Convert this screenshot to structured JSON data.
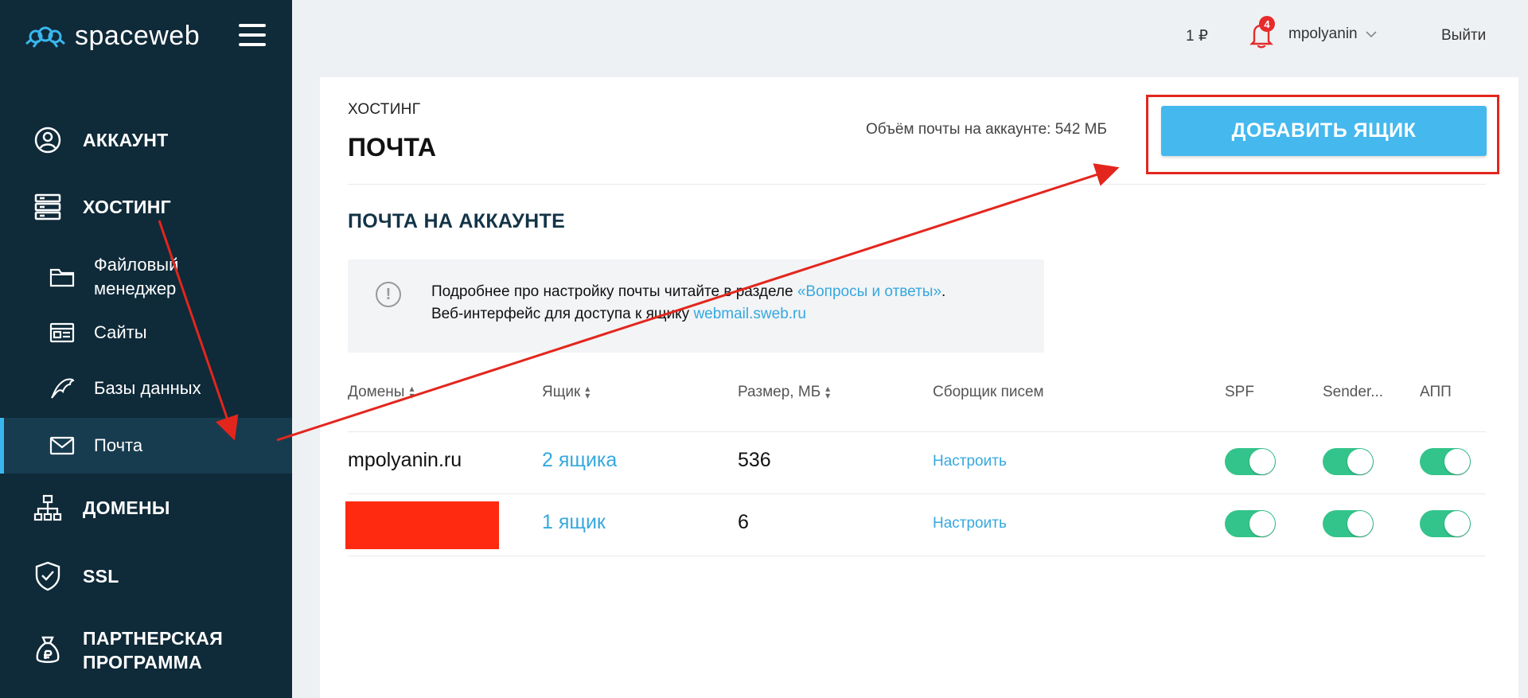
{
  "logo": {
    "text": "spaceweb"
  },
  "sidebar": {
    "items": [
      {
        "label": "АККАУНТ",
        "icon": "user-circle-icon"
      },
      {
        "label": "ХОСТИНГ",
        "icon": "server-icon"
      },
      {
        "label": "Файловый менеджер",
        "icon": "folder-icon"
      },
      {
        "label": "Сайты",
        "icon": "browser-window-icon"
      },
      {
        "label": "Базы данных",
        "icon": "dolphin-icon"
      },
      {
        "label": "Почта",
        "icon": "envelope-icon"
      },
      {
        "label": "ДОМЕНЫ",
        "icon": "sitemap-icon"
      },
      {
        "label": "SSL",
        "icon": "shield-check-icon"
      },
      {
        "label": "ПАРТНЕРСКАЯ ПРОГРАММА",
        "icon": "money-bag-icon"
      }
    ],
    "active": "Почта"
  },
  "header": {
    "balance": "1 ₽",
    "notifications_count": "4",
    "username": "mpolyanin",
    "logout": "Выйти"
  },
  "page": {
    "breadcrumb": "ХОСТИНГ",
    "title": "ПОЧТА",
    "volume": "Объём почты на аккаунте: 542 МБ",
    "add_button": "ДОБАВИТЬ ЯЩИК",
    "section_title": "ПОЧТА НА АККАУНТЕ",
    "info": {
      "line1_text": "Подробнее про настройку почты читайте в разделе ",
      "line1_link": "«Вопросы и ответы»",
      "line1_end": ".",
      "line2_text": "Веб-интерфейс для доступа к ящику ",
      "line2_link": "webmail.sweb.ru"
    }
  },
  "table": {
    "columns": [
      "Домены",
      "Ящик",
      "Размер, МБ",
      "Сборщик писем",
      "SPF",
      "Sender...",
      "АПП"
    ],
    "rows": [
      {
        "domain": "mpolyanin.ru",
        "mailboxes": "2 ящика",
        "size": "536",
        "collector": "Настроить",
        "spf": true,
        "sender": true,
        "app": true
      },
      {
        "domain": "",
        "mailboxes": "1 ящик",
        "size": "6",
        "collector": "Настроить",
        "spf": true,
        "sender": true,
        "app": true
      }
    ]
  },
  "colors": {
    "sidebar_bg": "#0f2a39",
    "accent": "#45b8ee",
    "toggle_on": "#33c48b",
    "annotation_red": "#e3261d"
  }
}
